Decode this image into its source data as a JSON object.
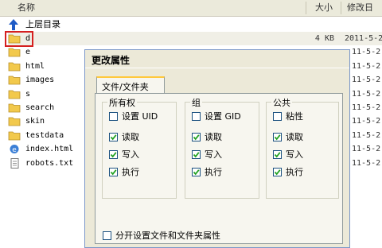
{
  "header": {
    "name_label": "名称",
    "size_label": "大小",
    "date_label": "修改日"
  },
  "parent_link": {
    "label": "上层目录"
  },
  "files": [
    {
      "name": "d",
      "type": "folder",
      "size": "4 KB",
      "date": "2011-5-2"
    },
    {
      "name": "e",
      "type": "folder",
      "size": "",
      "date": "11-5-2"
    },
    {
      "name": "html",
      "type": "folder",
      "size": "",
      "date": "11-5-2"
    },
    {
      "name": "images",
      "type": "folder",
      "size": "",
      "date": "11-5-2"
    },
    {
      "name": "s",
      "type": "folder",
      "size": "",
      "date": "11-5-2"
    },
    {
      "name": "search",
      "type": "folder",
      "size": "",
      "date": "11-5-2"
    },
    {
      "name": "skin",
      "type": "folder",
      "size": "",
      "date": "11-5-2"
    },
    {
      "name": "testdata",
      "type": "folder",
      "size": "",
      "date": "11-5-2"
    },
    {
      "name": "index.html",
      "type": "html",
      "size": "",
      "date": "11-5-2"
    },
    {
      "name": "robots.txt",
      "type": "text",
      "size": "",
      "date": "11-5-2"
    }
  ],
  "dialog": {
    "title": "更改属性",
    "tab": "文件/文件夹",
    "groups": [
      {
        "label": "所有权",
        "items": [
          {
            "label": "设置 UID",
            "checked": false
          },
          {
            "label": "读取",
            "checked": true
          },
          {
            "label": "写入",
            "checked": true
          },
          {
            "label": "执行",
            "checked": true
          }
        ]
      },
      {
        "label": "组",
        "items": [
          {
            "label": "设置 GID",
            "checked": false
          },
          {
            "label": "读取",
            "checked": true
          },
          {
            "label": "写入",
            "checked": true
          },
          {
            "label": "执行",
            "checked": true
          }
        ]
      },
      {
        "label": "公共",
        "items": [
          {
            "label": "粘性",
            "checked": false
          },
          {
            "label": "读取",
            "checked": true
          },
          {
            "label": "写入",
            "checked": true
          },
          {
            "label": "执行",
            "checked": true
          }
        ]
      }
    ],
    "separate_option": {
      "label": "分开设置文件和文件夹属性",
      "checked": false
    }
  },
  "colors": {
    "highlight": "#d51f1f",
    "folder": "#f2c94c",
    "dialog_bg": "#ece9d8"
  }
}
